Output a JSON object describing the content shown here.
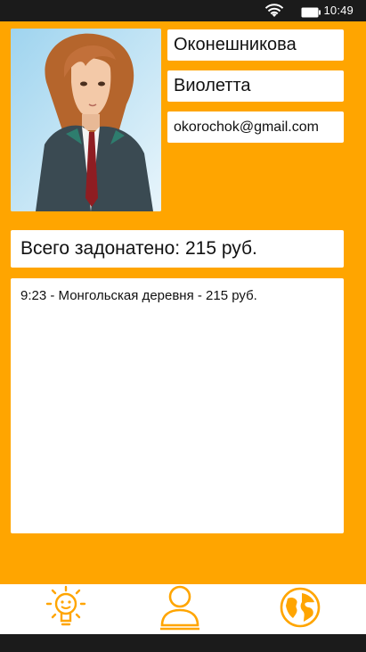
{
  "status_bar": {
    "time": "10:49"
  },
  "profile": {
    "last_name": "Оконешникова",
    "first_name": "Виолетта",
    "email": "okorochok@gmail.com"
  },
  "donations": {
    "total_text": "Всего задонатено: 215 руб.",
    "history": [
      {
        "text": "9:23 - Монгольская деревня - 215 руб."
      }
    ]
  },
  "bottom_nav": {
    "items": [
      {
        "icon": "lightbulb-icon"
      },
      {
        "icon": "user-icon"
      },
      {
        "icon": "globe-icon"
      }
    ]
  },
  "colors": {
    "accent": "#ffa500",
    "statusbar": "#1b1b1b",
    "card": "#ffffff"
  }
}
